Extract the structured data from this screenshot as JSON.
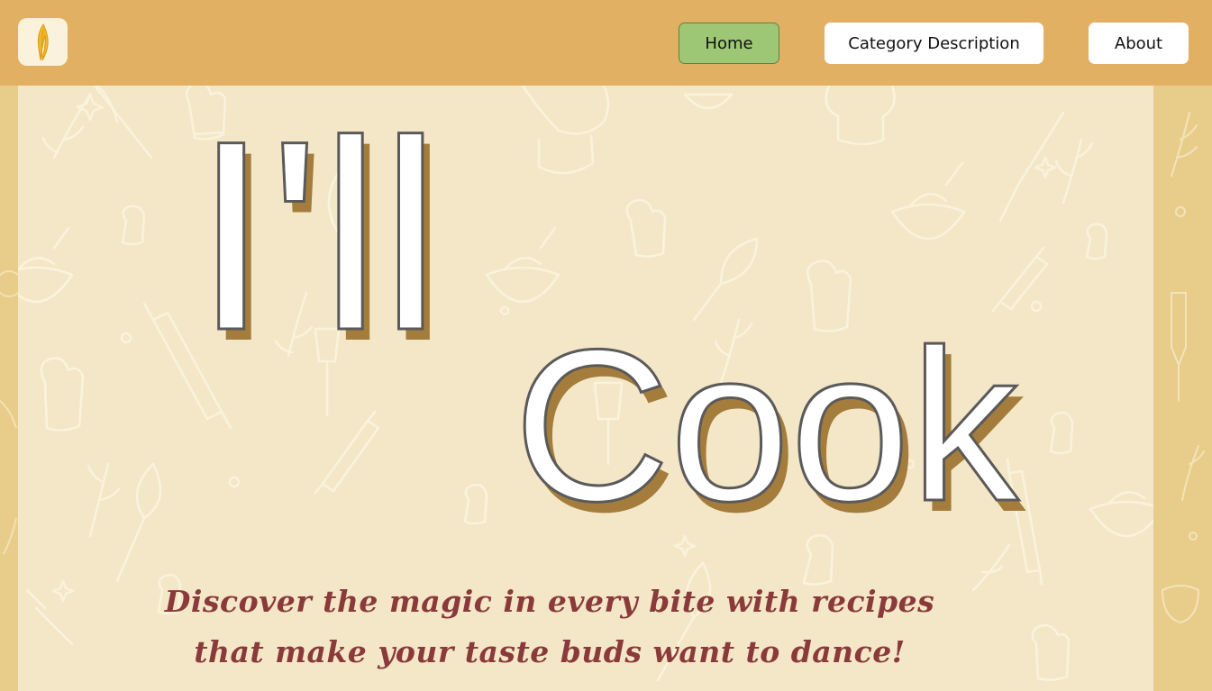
{
  "nav": {
    "logo_icon": "flame-feather-icon",
    "home_label": "Home",
    "category_label": "Category Description",
    "about_label": "About",
    "active": "Home"
  },
  "hero": {
    "title_line1": "I'll",
    "title_line2": "Cook",
    "tagline_line1": "Discover the magic in every bite with recipes",
    "tagline_line2": "that make your taste buds want to dance!",
    "background_icons": [
      "whisk-icon",
      "oven-mitt-icon",
      "rolling-pin-icon",
      "mixing-bowl-icon",
      "chef-hat-icon",
      "spatula-icon",
      "sparkle-icon",
      "leaf-icon"
    ]
  },
  "colors": {
    "navbar": "#e1b063",
    "hero_bg": "#f4e7c7",
    "side_bg": "#e8cd8a",
    "home_button": "#9ec775",
    "title_shadow": "#a47c3b",
    "tagline": "#8a3a3a"
  }
}
